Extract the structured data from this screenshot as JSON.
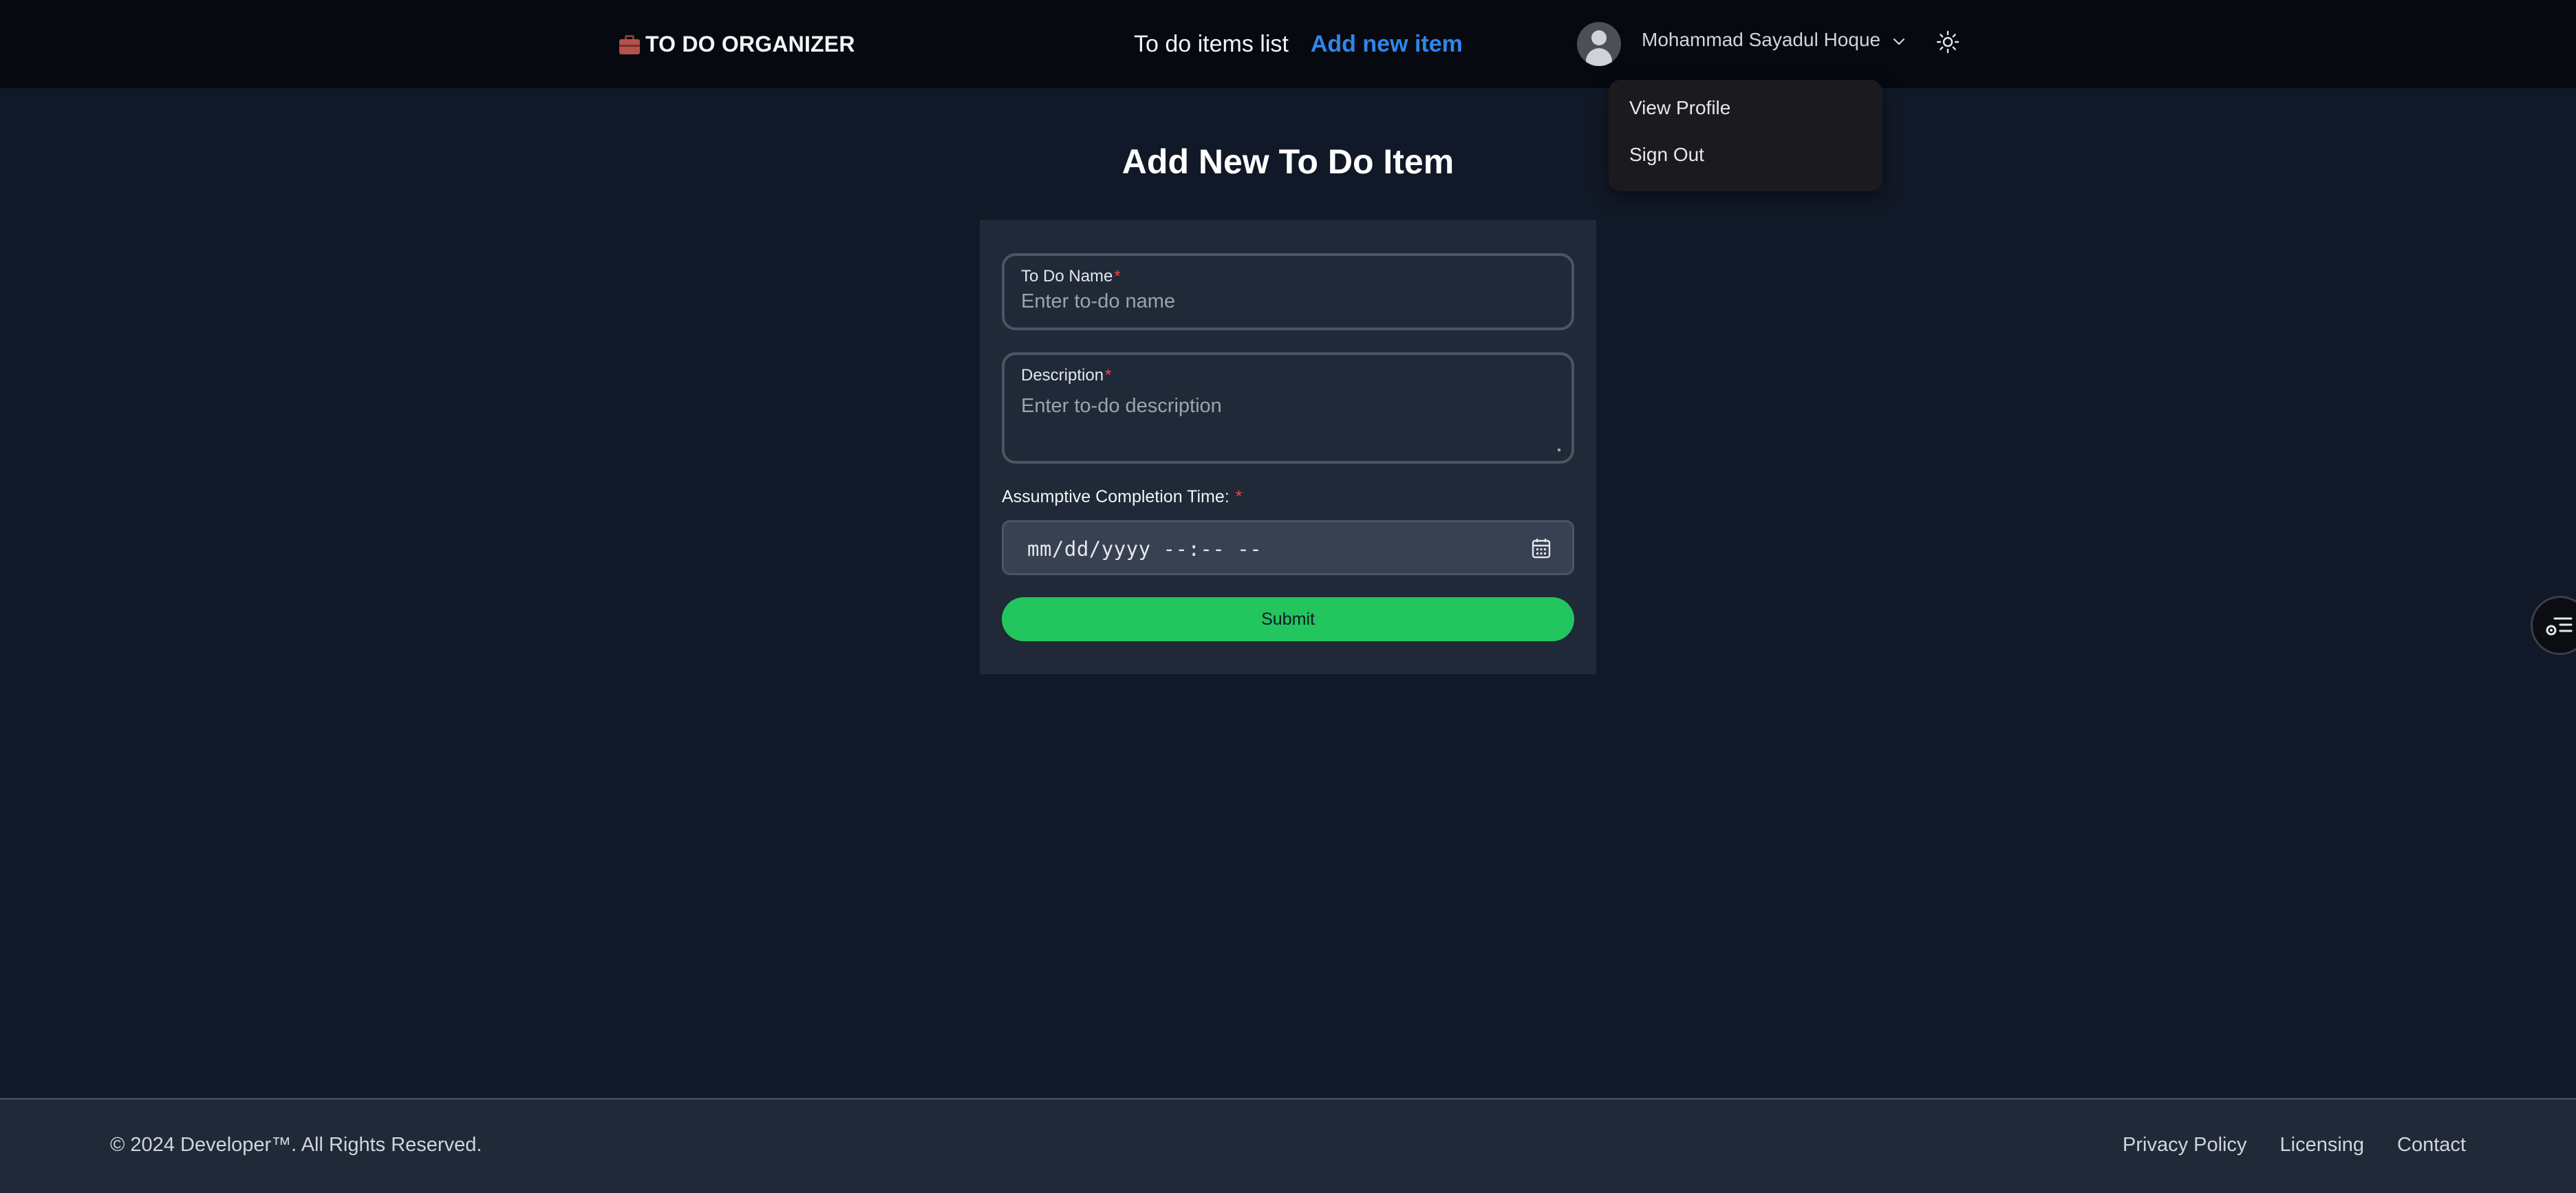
{
  "brand": {
    "title": "TO DO ORGANIZER",
    "icon": "briefcase-icon"
  },
  "nav": {
    "items": [
      {
        "label": "To do items list",
        "active": false
      },
      {
        "label": "Add new item",
        "active": true
      }
    ]
  },
  "user": {
    "name": "Mohammad Sayadul Hoque",
    "avatar_icon": "user-avatar-icon",
    "chevron_icon": "chevron-down-icon",
    "theme_icon": "sun-icon"
  },
  "user_menu": {
    "items": [
      {
        "label": "View Profile"
      },
      {
        "label": "Sign Out"
      }
    ]
  },
  "page": {
    "title": "Add New To Do Item"
  },
  "form": {
    "name_label": "To Do Name",
    "name_placeholder": "Enter to-do name",
    "description_label": "Description",
    "description_placeholder": "Enter to-do description",
    "required_mark": "*",
    "completion_label": "Assumptive Completion Time:",
    "completion_value": "mm/dd/yyyy --:-- --",
    "calendar_icon": "calendar-icon",
    "submit_label": "Submit"
  },
  "floating_button": {
    "icon": "settings-list-icon"
  },
  "footer": {
    "copyright": "© 2024 Developer™. All Rights Reserved.",
    "links": [
      {
        "label": "Privacy Policy"
      },
      {
        "label": "Licensing"
      },
      {
        "label": "Contact"
      }
    ]
  },
  "colors": {
    "background": "#111827",
    "navbar": "#060910",
    "card": "#1f2937",
    "accent_link": "#2f86eb",
    "submit": "#22c55e",
    "required": "#ef4444"
  }
}
